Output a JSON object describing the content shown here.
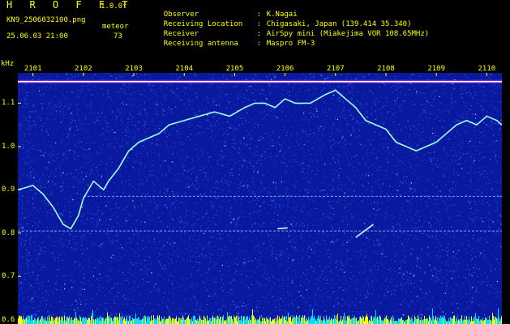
{
  "header": {
    "brand": "H R O F F T",
    "version": "1.0.0f",
    "filename": "KN9_2506032100.png",
    "meteor_label": "meteor",
    "datetime": "25.06.03 21:00",
    "meteor_count": "73"
  },
  "info": [
    {
      "label": "Observer",
      "value": "K.Nagai"
    },
    {
      "label": "Receiving Location",
      "value": "Chigasaki, Japan (139.414 35.340)"
    },
    {
      "label": "Receiver",
      "value": "AirSpy mini (Miakejima VOR 108.65MHz)"
    },
    {
      "label": "Receiving antenna",
      "value": "Maspro FM-3"
    }
  ],
  "chart_data": {
    "type": "heatmap",
    "title": "",
    "xlabel": "",
    "ylabel": "kHz",
    "x_ticks": [
      "2101",
      "2102",
      "2103",
      "2104",
      "2105",
      "2106",
      "2107",
      "2108",
      "2109",
      "2110"
    ],
    "x_range": [
      2100.7,
      2110.3
    ],
    "y_ticks": [
      0.6,
      0.7,
      0.8,
      0.9,
      1.0,
      1.1
    ],
    "ylim": [
      0.59,
      1.17
    ],
    "colors": {
      "background": "#0a1aa0",
      "noise": "#3c78ff",
      "trace": "#a0ffe6",
      "carrier": "#ffffff",
      "label": "#ffff00"
    },
    "carrier_khz": 1.15,
    "meteor_trace": {
      "x": [
        2100.7,
        2101.0,
        2101.2,
        2101.4,
        2101.5,
        2101.6,
        2101.75,
        2101.9,
        2102.0,
        2102.2,
        2102.4,
        2102.5,
        2102.7,
        2102.9,
        2103.1,
        2103.3,
        2103.5,
        2103.7,
        2104.0,
        2104.3,
        2104.6,
        2104.9,
        2105.2,
        2105.4,
        2105.6,
        2105.8,
        2106.0,
        2106.2,
        2106.5,
        2106.8,
        2107.0,
        2107.2,
        2107.4,
        2107.6,
        2107.8,
        2108.0,
        2108.2,
        2108.4,
        2108.6,
        2108.8,
        2109.0,
        2109.2,
        2109.4,
        2109.6,
        2109.8,
        2110.0,
        2110.2,
        2110.3
      ],
      "y": [
        0.9,
        0.91,
        0.89,
        0.86,
        0.84,
        0.82,
        0.81,
        0.84,
        0.88,
        0.92,
        0.9,
        0.92,
        0.95,
        0.99,
        1.01,
        1.02,
        1.03,
        1.05,
        1.06,
        1.07,
        1.08,
        1.07,
        1.09,
        1.1,
        1.1,
        1.09,
        1.11,
        1.1,
        1.1,
        1.12,
        1.13,
        1.11,
        1.09,
        1.06,
        1.05,
        1.04,
        1.01,
        1.0,
        0.99,
        1.0,
        1.01,
        1.03,
        1.05,
        1.06,
        1.05,
        1.07,
        1.06,
        1.05
      ]
    },
    "flat_traces": [
      {
        "x": [
          2100.7,
          2110.3
        ],
        "y": [
          0.805,
          0.805
        ]
      },
      {
        "x": [
          2102.0,
          2110.3
        ],
        "y": [
          0.885,
          0.885
        ]
      }
    ],
    "meteor_echoes": [
      {
        "x": [
          2107.4,
          2107.75
        ],
        "y": [
          0.79,
          0.82
        ]
      },
      {
        "x": [
          2105.85,
          2106.05
        ],
        "y": [
          0.81,
          0.812
        ]
      }
    ]
  }
}
